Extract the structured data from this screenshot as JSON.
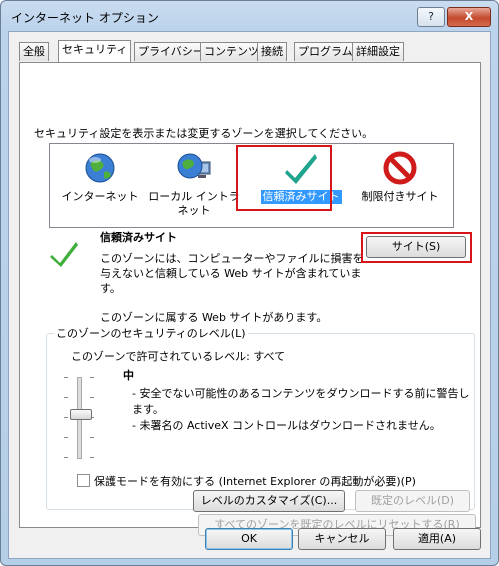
{
  "window": {
    "title": "インターネット オプション",
    "help_label": "?",
    "close_label": "X"
  },
  "tabs": [
    "全般",
    "セキュリティ",
    "プライバシー",
    "コンテンツ",
    "接続",
    "プログラム",
    "詳細設定"
  ],
  "active_tab_index": 1,
  "zone_prompt": "セキュリティ設定を表示または変更するゾーンを選択してください。",
  "zones": [
    {
      "label": "インターネット",
      "icon": "globe-icon"
    },
    {
      "label": "ローカル イントラネット",
      "icon": "intranet-globe-icon"
    },
    {
      "label": "信頼済みサイト",
      "icon": "checkmark-icon"
    },
    {
      "label": "制限付きサイト",
      "icon": "no-entry-icon"
    }
  ],
  "selected_zone_index": 2,
  "zone_detail": {
    "title": "信頼済みサイト",
    "description": "このゾーンには、コンピューターやファイルに損害を与えないと信頼している Web サイトが含まれています。",
    "sites_button": "サイト(S)",
    "sites_note": "このゾーンに属する Web サイトがあります。"
  },
  "security_level": {
    "group_label": "このゾーンのセキュリティのレベル(L)",
    "allowed_label": "このゾーンで許可されているレベル: すべて",
    "level_name": "中",
    "bullets": [
      "- 安全でない可能性のあるコンテンツをダウンロードする前に警告します。",
      "- 未署名の ActiveX コントロールはダウンロードされません。"
    ],
    "protected_mode_label": "保護モードを有効にする (Internet Explorer の再起動が必要)(P)",
    "protected_mode_checked": false,
    "custom_button": "レベルのカスタマイズ(C)...",
    "default_button": "既定のレベル(D)"
  },
  "reset_all_button": "すべてのゾーンを既定のレベルにリセットする(R)",
  "footer": {
    "ok": "OK",
    "cancel": "キャンセル",
    "apply": "適用(A)"
  },
  "colors": {
    "highlight_box": "#d8141b",
    "selection": "#3399ff"
  }
}
